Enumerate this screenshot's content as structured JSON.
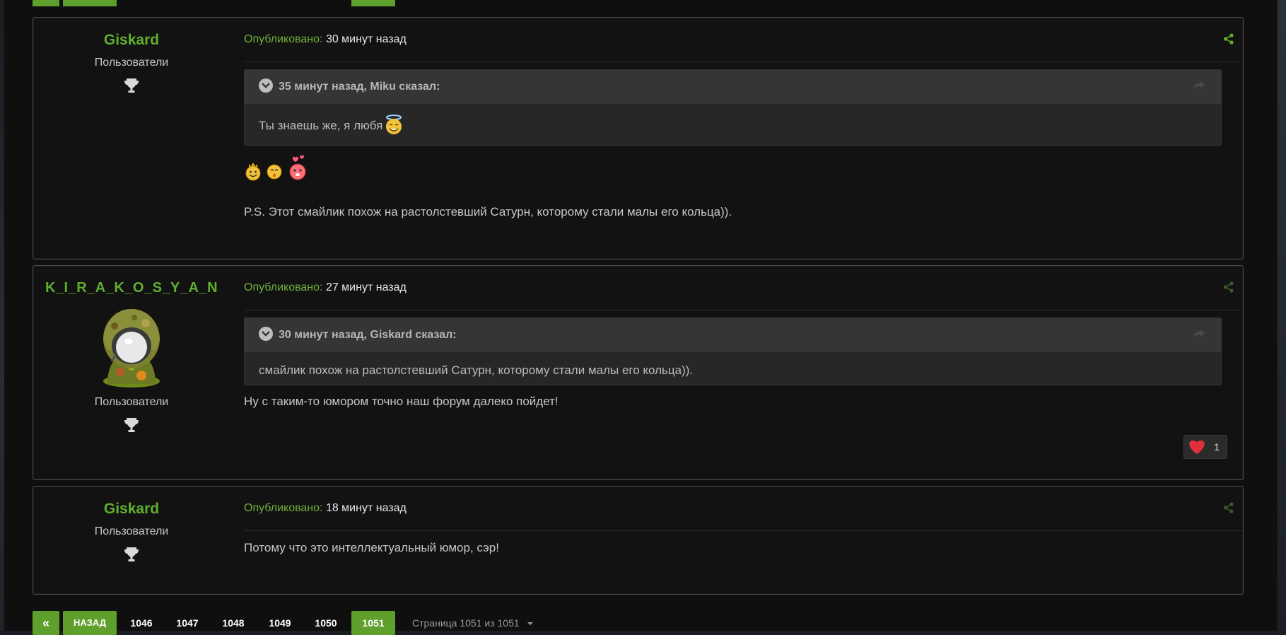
{
  "posts": [
    {
      "author": "Giskard",
      "group": "Пользователи",
      "meta_label": "Опубликовано:",
      "time": "30 минут назад",
      "quote": {
        "header": "35 минут назад, Miku сказал:",
        "text": "Ты знаешь же, я любя"
      },
      "text": "P.S. Этот смайлик похож на растолстевший Сатурн, которому стали малы его кольца))."
    },
    {
      "author": "K_I_R_A_K_O_S_Y_A_N",
      "group": "Пользователи",
      "meta_label": "Опубликовано:",
      "time": "27 минут назад",
      "quote": {
        "header": "30 минут назад, Giskard сказал:",
        "text": "смайлик похож на растолстевший Сатурн, которому стали малы его кольца))."
      },
      "text": "Ну с таким-то юмором точно наш форум далеко пойдет!",
      "reaction_count": "1"
    },
    {
      "author": "Giskard",
      "group": "Пользователи",
      "meta_label": "Опубликовано:",
      "time": "18 минут назад",
      "text": "Потому что это интеллектуальный юмор, сэр!"
    }
  ],
  "pagination": {
    "first": "«",
    "prev": "НАЗАД",
    "pages": [
      "1046",
      "1047",
      "1048",
      "1049",
      "1050",
      "1051"
    ],
    "current": "1051",
    "info": "Страница 1051 из 1051"
  },
  "colors": {
    "accent": "#5f9f2c",
    "name": "#5fae2e",
    "border": "#4b4b4b"
  }
}
